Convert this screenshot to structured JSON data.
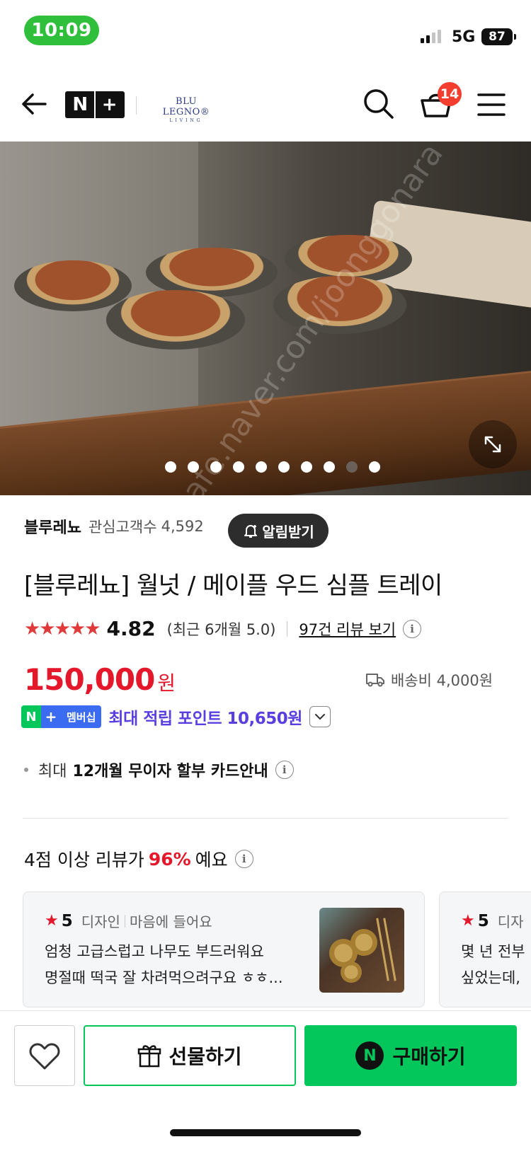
{
  "status_bar": {
    "time": "10:09",
    "network": "5G",
    "battery": "87"
  },
  "header": {
    "logo_text": "N",
    "brand_main": "BLU LEGNO®",
    "brand_sub": "LIVING",
    "cart_count": "14"
  },
  "hero": {
    "watermark": "cafe.naver.com/joonggonara",
    "slide_count": 10,
    "active_slide": 9
  },
  "store": {
    "name": "블루레뇨",
    "fan_label": "관심고객수",
    "fan_count": "4,592",
    "alarm_label": "알림받기"
  },
  "product": {
    "title": "[블루레뇨] 월넛 / 메이플 우드 심플 트레이",
    "stars": "★★★★★",
    "rating": "4.82",
    "rating_recent": "(최근 6개월 5.0)",
    "review_link": "97건 리뷰 보기",
    "price": "150,000",
    "price_unit": "원",
    "shipping": "배송비 4,000원",
    "member_badge": "멤버십",
    "point_text": "최대 적립 포인트 10,650원",
    "installment_pre": "최대",
    "installment_strong": "12개월 무이자 할부 카드안내"
  },
  "review_summary": {
    "pre": "4점 이상 리뷰가",
    "pct": "96%",
    "post": "예요"
  },
  "review_cards": [
    {
      "score": "5",
      "tag1": "디자인",
      "tag2": "마음에 들어요",
      "line1": "엄청 고급스럽고 나무도 부드러워요",
      "line2": "명절때 떡국 잘 차려먹으려구요 ㅎㅎ..."
    },
    {
      "score": "5",
      "tag1": "디자",
      "line1": "몇 년 전부",
      "line2": "싶었는데,"
    }
  ],
  "bottom": {
    "gift_label": "선물하기",
    "buy_label": "구매하기",
    "buy_icon": "N"
  },
  "colors": {
    "naver_green": "#03c75a",
    "price_red": "#e4172b",
    "point_purple": "#5a3fe0",
    "membership_blue": "#3b6bf0"
  }
}
